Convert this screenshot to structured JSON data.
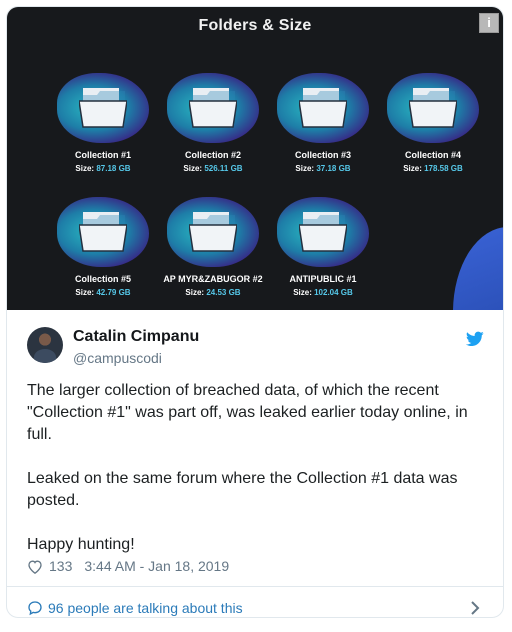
{
  "media": {
    "title": "Folders & Size",
    "info_label": "i",
    "size_label": "Size:",
    "folders": [
      {
        "name": "Collection #1",
        "size": "87.18 GB"
      },
      {
        "name": "Collection #2",
        "size": "526.11 GB"
      },
      {
        "name": "Collection #3",
        "size": "37.18 GB"
      },
      {
        "name": "Collection #4",
        "size": "178.58 GB"
      },
      {
        "name": "Collection #5",
        "size": "42.79 GB"
      },
      {
        "name": "AP MYR&ZABUGOR #2",
        "size": "24.53 GB"
      },
      {
        "name": "ANTIPUBLIC #1",
        "size": "102.04 GB"
      }
    ]
  },
  "author": {
    "name": "Catalin Cimpanu",
    "handle": "@campuscodi"
  },
  "tweet": {
    "paragraphs": [
      "The larger collection of breached data, of which the recent \"Collection #1\" was part off, was leaked earlier today online, in full.",
      "Leaked on the same forum where the Collection #1 data was posted.",
      "Happy hunting!"
    ],
    "likes": "133",
    "timestamp": "3:44 AM - Jan 18, 2019",
    "talking": "96 people are talking about this"
  },
  "colors": {
    "brand": "#1da1f2",
    "link": "#2b7bb9",
    "size_value": "#56c8e9"
  }
}
